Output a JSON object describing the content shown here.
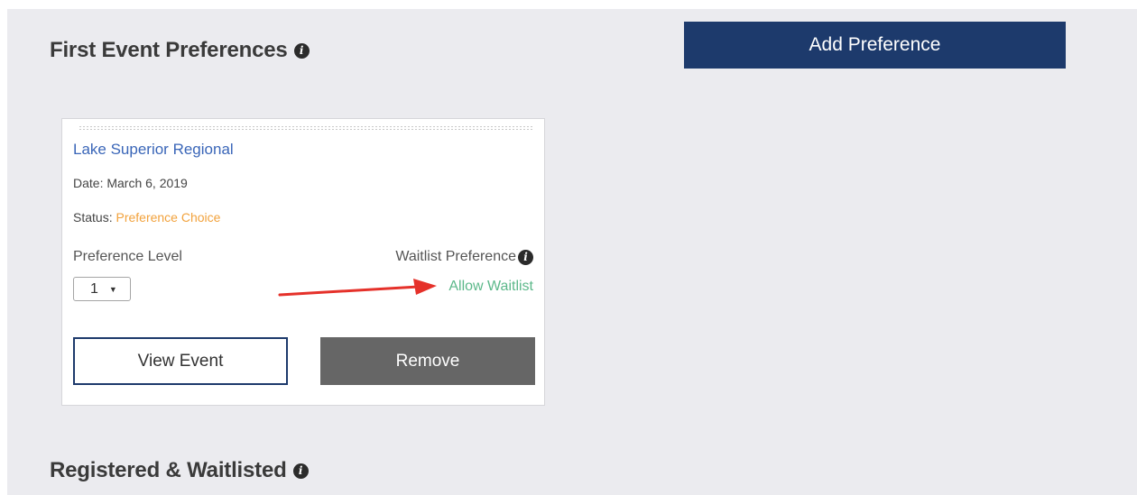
{
  "first_event": {
    "title": "First Event Preferences",
    "add_button_label": "Add Preference"
  },
  "card": {
    "event_name": "Lake Superior Regional",
    "date_line": "Date: March 6, 2019",
    "status_label": "Status:",
    "status_value": "Preference Choice",
    "preference_level_label": "Preference Level",
    "preference_level_value": "1",
    "waitlist_label": "Waitlist Preference",
    "waitlist_value": "Allow Waitlist",
    "view_button_label": "View Event",
    "remove_button_label": "Remove"
  },
  "registered": {
    "title": "Registered & Waitlisted"
  },
  "icons": {
    "info": "i",
    "caret": "▼"
  },
  "colors": {
    "panel_background": "#ebebef",
    "primary_button": "#1d3a6c",
    "remove_button": "#666666",
    "link": "#3a66b8",
    "status": "#f2a23c",
    "waitlist": "#5cb88a",
    "annotation_arrow": "#e5312a"
  }
}
